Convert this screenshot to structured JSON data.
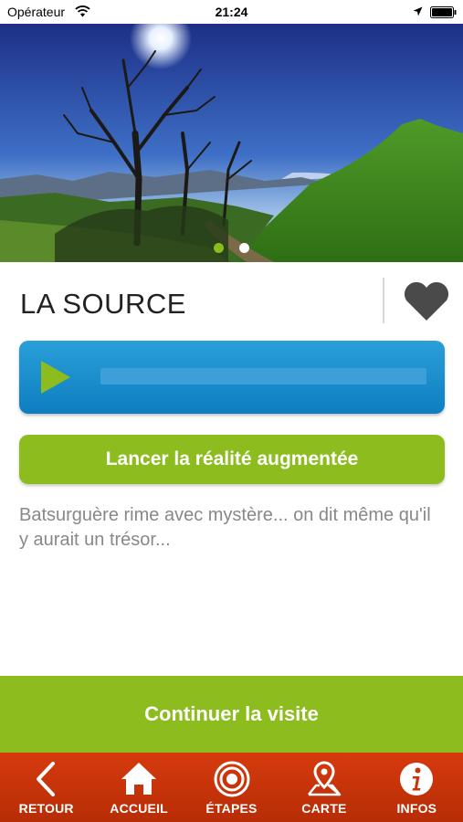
{
  "status_bar": {
    "carrier": "Opérateur",
    "time": "21:24"
  },
  "hero": {
    "slide_count": 2,
    "active_slide": 1
  },
  "detail": {
    "title": "LA SOURCE",
    "ar_button_label": "Lancer la réalité augmentée",
    "description": "Batsurguère rime avec mystère... on dit même qu'il y aurait un trésor...",
    "audio_progress": 0
  },
  "continue_label": "Continuer la visite",
  "tabs": [
    {
      "label": "RETOUR",
      "icon": "back-chevron-icon"
    },
    {
      "label": "ACCUEIL",
      "icon": "home-icon"
    },
    {
      "label": "ÉTAPES",
      "icon": "target-icon"
    },
    {
      "label": "CARTE",
      "icon": "map-pin-icon"
    },
    {
      "label": "INFOS",
      "icon": "info-icon"
    }
  ],
  "colors": {
    "green": "#8cbc1e",
    "blue": "#1a8fd0",
    "red": "#c83308",
    "heart": "#4a4a4a"
  }
}
